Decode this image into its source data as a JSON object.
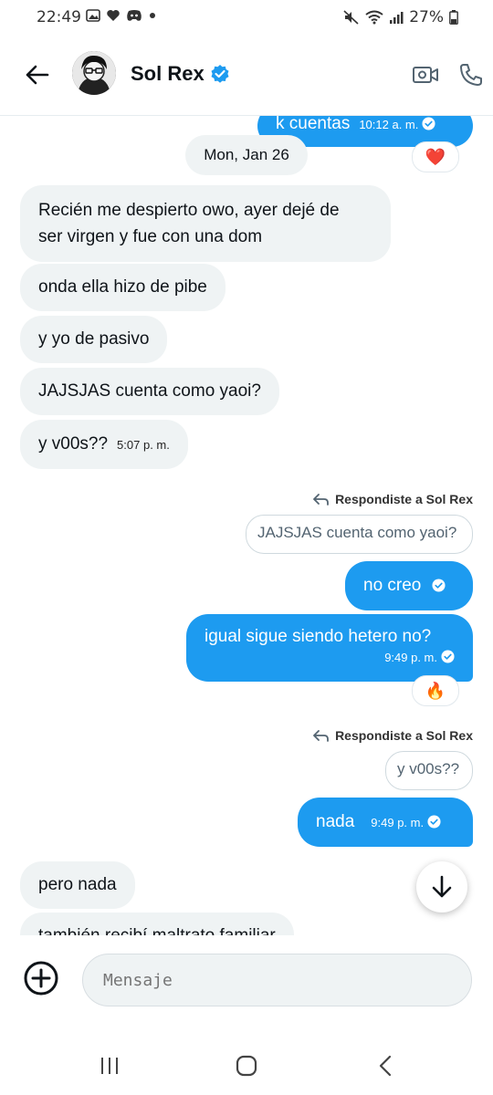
{
  "status_bar": {
    "time": "22:49",
    "battery": "27%"
  },
  "header": {
    "name": "Sol Rex"
  },
  "chat": {
    "top_partial_message": {
      "text": "k cuentas",
      "time": "10:12 a. m."
    },
    "reaction_heart": "❤️",
    "date_separator": "Mon, Jan 26",
    "incoming_1": {
      "line1": "Recién me despierto owo, ayer dejé de",
      "line2": "ser virgen y fue con una dom"
    },
    "incoming_2": "onda ella hizo de pibe",
    "incoming_3": "y yo de pasivo",
    "incoming_4": "JAJSJAS cuenta como yaoi?",
    "incoming_5": {
      "text": "y v00s??",
      "time": "5:07 p. m."
    },
    "reply_1": {
      "label": "Respondiste a Sol Rex",
      "quote": "JAJSJAS cuenta como yaoi?"
    },
    "outgoing_1": "no creo",
    "outgoing_2": {
      "text": "igual sigue siendo hetero no?",
      "time": "9:49 p. m."
    },
    "reaction_fire": "🔥",
    "reply_2": {
      "label": "Respondiste a Sol Rex",
      "quote": "y v00s??"
    },
    "outgoing_3": {
      "text": "nada",
      "time": "9:49 p. m."
    },
    "incoming_6": "pero nada",
    "incoming_7_partial": "también recibí maltrato familiar"
  },
  "composer": {
    "placeholder": "Mensaje"
  },
  "icons": {
    "back": "arrow-left-icon",
    "verified": "verified-badge-icon",
    "video": "video-call-icon",
    "phone": "phone-icon",
    "scroll_down": "arrow-down-icon",
    "add": "plus-circle-icon",
    "read": "check-circle-icon",
    "reply": "reply-arrow-icon"
  },
  "colors": {
    "accent": "#1d9bf0",
    "incoming_bg": "#eff3f4",
    "text": "#0f1419"
  }
}
